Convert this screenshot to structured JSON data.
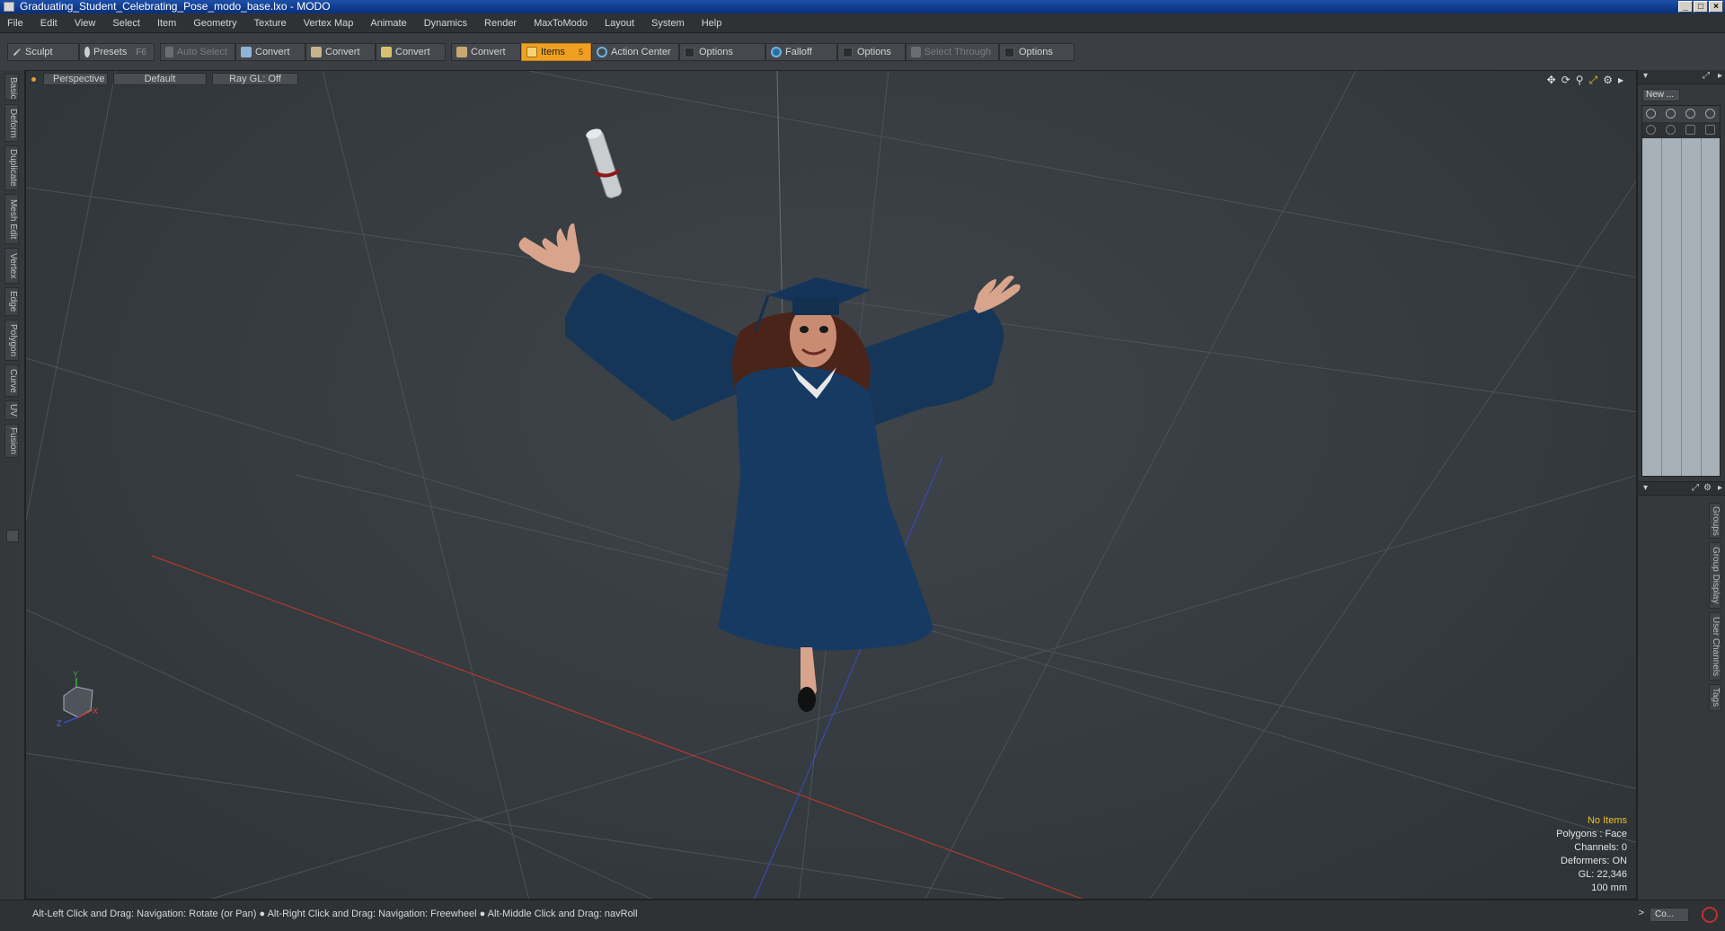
{
  "window": {
    "title": "Graduating_Student_Celebrating_Pose_modo_base.lxo - MODO",
    "controls": [
      "_",
      "□",
      "×"
    ]
  },
  "menu": [
    "File",
    "Edit",
    "View",
    "Select",
    "Item",
    "Geometry",
    "Texture",
    "Vertex Map",
    "Animate",
    "Dynamics",
    "Render",
    "MaxToModo",
    "Layout",
    "System",
    "Help"
  ],
  "toolbar": {
    "sculpt": "Sculpt",
    "presets": "Presets",
    "presets_key": "F6",
    "auto_select": "Auto Select",
    "convert1": "Convert",
    "convert2": "Convert",
    "convert3": "Convert",
    "convert4": "Convert",
    "items": "Items",
    "items_key": "5",
    "action_center": "Action Center",
    "options1": "Options",
    "falloff": "Falloff",
    "options2": "Options",
    "select_through": "Select Through",
    "options3": "Options"
  },
  "left_tabs": [
    "Basic",
    "Deform",
    "Duplicate",
    "Mesh Edit",
    "Vertex",
    "Edge",
    "Polygon",
    "Curve",
    "UV",
    "Fusion"
  ],
  "viewport": {
    "view": "Perspective",
    "style": "Default",
    "raygl": "Ray GL: Off",
    "info": {
      "items": "No Items",
      "polygons": "Polygons : Face",
      "channels": "Channels: 0",
      "deformers": "Deformers: ON",
      "gl": "GL: 22,346",
      "scale": "100 mm"
    }
  },
  "right_panel": {
    "new_button": "New ...",
    "tabs": [
      "Groups",
      "Group Display",
      "User Channels",
      "Tags"
    ]
  },
  "status": {
    "hint": "Alt-Left Click and Drag: Navigation: Rotate (or Pan) ● Alt-Right Click and Drag: Navigation: Freewheel ● Alt-Middle Click and Drag: navRoll",
    "command_label": "Co...",
    "arrow": ">"
  },
  "colors": {
    "accent": "#f0a020",
    "gown": "#173a63",
    "skin": "#d9a48c"
  }
}
